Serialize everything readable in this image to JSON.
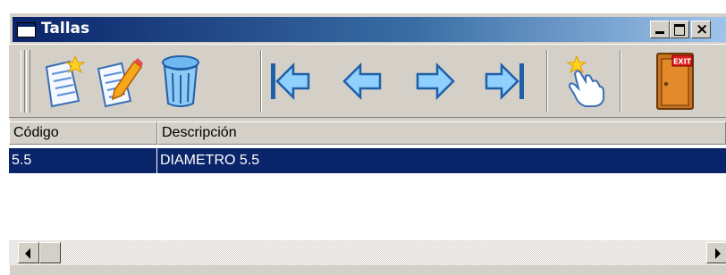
{
  "window": {
    "title": "Tallas"
  },
  "toolbar": {
    "buttons": [
      {
        "name": "new",
        "icon": "new-document-icon"
      },
      {
        "name": "edit",
        "icon": "edit-document-icon"
      },
      {
        "name": "delete",
        "icon": "trash-can-icon"
      },
      {
        "name": "first",
        "icon": "first-record-icon"
      },
      {
        "name": "previous",
        "icon": "previous-record-icon"
      },
      {
        "name": "next",
        "icon": "next-record-icon"
      },
      {
        "name": "last",
        "icon": "last-record-icon"
      },
      {
        "name": "select",
        "icon": "pointing-hand-icon"
      },
      {
        "name": "exit",
        "icon": "exit-door-icon",
        "label": "EXIT"
      }
    ]
  },
  "table": {
    "columns": [
      "Código",
      "Descripción"
    ],
    "rows": [
      {
        "codigo": "5.5",
        "descripcion": "DIAMETRO 5.5",
        "selected": true
      }
    ]
  },
  "colors": {
    "selection": "#0a246a",
    "title_start": "#0a246a",
    "title_end": "#a6caf0",
    "face": "#d4d0c8"
  }
}
